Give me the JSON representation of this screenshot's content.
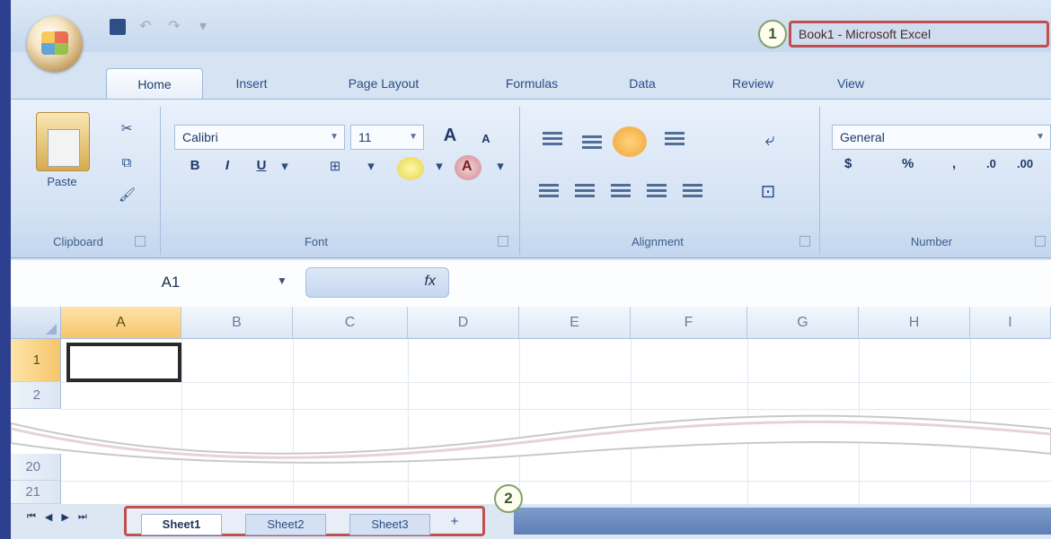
{
  "window": {
    "title": "Book1 - Microsoft Excel",
    "callout_1": "1",
    "callout_2": "2"
  },
  "quick_access": [
    "save",
    "undo",
    "redo",
    "customize"
  ],
  "tabs": [
    {
      "label": "Home",
      "active": true
    },
    {
      "label": "Insert"
    },
    {
      "label": "Page Layout"
    },
    {
      "label": "Formulas"
    },
    {
      "label": "Data"
    },
    {
      "label": "Review"
    },
    {
      "label": "View"
    }
  ],
  "ribbon": {
    "clipboard": {
      "paste_label": "Paste",
      "group_label": "Clipboard"
    },
    "font": {
      "font_name": "Calibri",
      "font_size": "11",
      "group_label": "Font",
      "bold": "B",
      "italic": "I",
      "underline": "U",
      "grow": "A",
      "shrink": "A"
    },
    "alignment": {
      "group_label": "Alignment"
    },
    "number": {
      "format": "General",
      "group_label": "Number",
      "currency": "$",
      "percent": "%",
      "comma": ",",
      "inc_decimal": ".0",
      "dec_decimal": ".00"
    }
  },
  "formula_bar": {
    "name_box": "A1",
    "fx": "fx",
    "formula": ""
  },
  "grid": {
    "columns": [
      "A",
      "B",
      "C",
      "D",
      "E",
      "F",
      "G",
      "H",
      "I"
    ],
    "rows": [
      "1",
      "2",
      "20",
      "21"
    ],
    "selected_cell": "A1"
  },
  "sheets": [
    "Sheet1",
    "Sheet2",
    "Sheet3"
  ],
  "colors": {
    "accent_red": "#c0504d",
    "ribbon_blue": "#d6e3f3",
    "selected_header": "#f6c56b"
  }
}
